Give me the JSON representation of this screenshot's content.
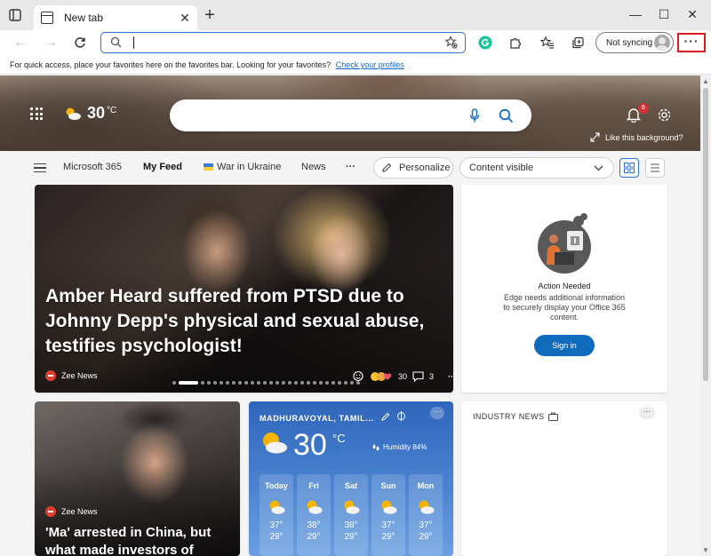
{
  "browser": {
    "tab_title": "New tab",
    "tab_close": "✕",
    "new_tab": "+",
    "window_controls": {
      "minimize": "—",
      "maximize": "☐",
      "close": "✕"
    },
    "address_value": "",
    "profile_label": "Not syncing",
    "more_label": "···"
  },
  "favorites_bar": {
    "text": "For quick access, place your favorites here on the favorites bar. Looking for your favorites?",
    "link": "Check your profiles"
  },
  "hero": {
    "temperature": "30",
    "unit": "°C",
    "search_value": "",
    "notification_count": "6",
    "like_background": "Like this background?"
  },
  "feed_nav": {
    "items": [
      "Microsoft 365",
      "My Feed",
      "War in Ukraine",
      "News"
    ],
    "more": "···",
    "personalize": "Personalize",
    "content_select": "Content visible"
  },
  "main_story": {
    "headline": "Amber Heard suffered from PTSD due to Johnny Depp's physical and sexual abuse, testifies psychologist!",
    "source": "Zee News",
    "reaction_count": "30",
    "comment_count": "3",
    "more": "···",
    "slide_count": 28,
    "active_slide": 1
  },
  "action_card": {
    "title": "Action Needed",
    "body": "Edge needs additional information to securely display your Office 365 content.",
    "button": "Sign in"
  },
  "ma_story": {
    "source": "Zee News",
    "headline": "'Ma' arrested in China, but what made investors of"
  },
  "weather": {
    "location": "MADHURAVOYAL, TAMIL...",
    "temperature": "30",
    "unit": "°C",
    "humidity": "Humidity 84%",
    "more": "···",
    "forecast": [
      {
        "day": "Today",
        "high": "37°",
        "low": "29°"
      },
      {
        "day": "Fri",
        "high": "38°",
        "low": "29°"
      },
      {
        "day": "Sat",
        "high": "38°",
        "low": "29°"
      },
      {
        "day": "Sun",
        "high": "37°",
        "low": "29°"
      },
      {
        "day": "Mon",
        "high": "37°",
        "low": "29°"
      }
    ]
  },
  "industry": {
    "title": "INDUSTRY NEWS",
    "more": "···"
  },
  "colors": {
    "accent": "#0f6cbd",
    "highlight_border": "#e0191c",
    "weather_bg": "#2f66bb"
  }
}
